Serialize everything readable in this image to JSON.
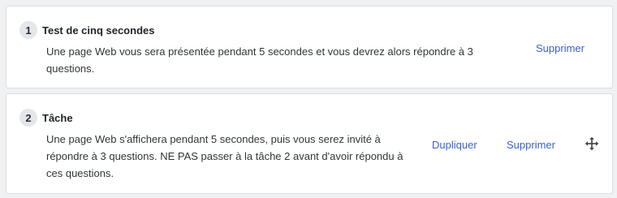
{
  "tasks": [
    {
      "number": "1",
      "title": "Test de cinq secondes",
      "description": "Une page Web vous sera présentée pendant 5 secondes et vous devrez alors répondre à 3 questions.",
      "delete_label": "Supprimer"
    },
    {
      "number": "2",
      "title": "Tâche",
      "description": "Une page Web s'affichera pendant 5 secondes, puis vous serez invité à répondre à 3 questions. NE PAS passer à la tâche 2 avant d'avoir répondu à ces questions.",
      "duplicate_label": "Dupliquer",
      "delete_label": "Supprimer",
      "drag_icon": "move-arrows-icon"
    }
  ],
  "colors": {
    "link": "#3a5fd0",
    "badge_bg": "#e4e6ea",
    "page_bg": "#f0f1f3"
  }
}
